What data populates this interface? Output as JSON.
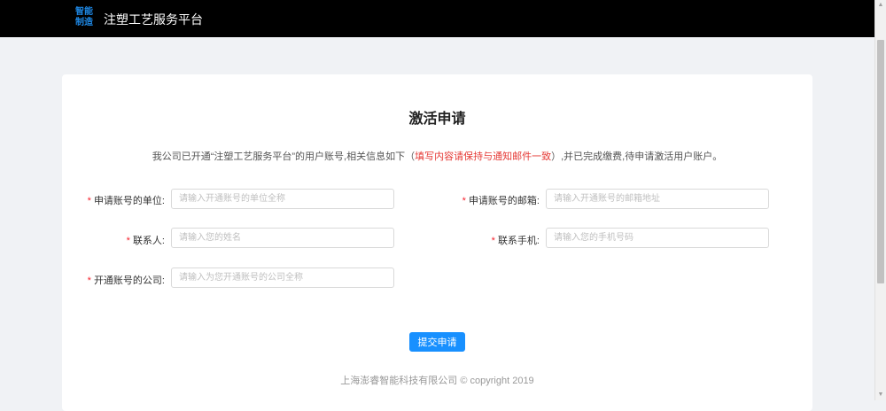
{
  "header": {
    "logo_line1": "智能",
    "logo_line2": "制造",
    "title": "注塑工艺服务平台"
  },
  "form": {
    "title": "激活申请",
    "intro_before": "我公司已开通“注塑工艺服务平台”的用户账号,相关信息如下（",
    "intro_highlight": "填写内容请保持与通知邮件一致",
    "intro_after": "）,并已完成缴费,待申请激活用户账户。",
    "required_mark": "*",
    "fields": [
      {
        "label": "申请账号的单位:",
        "placeholder": "请输入开通账号的单位全称"
      },
      {
        "label": "申请账号的邮箱:",
        "placeholder": "请输入开通账号的邮箱地址"
      },
      {
        "label": "联系人:",
        "placeholder": "请输入您的姓名"
      },
      {
        "label": "联系手机:",
        "placeholder": "请输入您的手机号码"
      },
      {
        "label": "开通账号的公司:",
        "placeholder": "请输入为您开通账号的公司全称"
      }
    ],
    "submit_label": "提交申请"
  },
  "footer": {
    "text": "上海澎睿智能科技有限公司 © copyright 2019"
  },
  "colors": {
    "header_bg": "#000000",
    "logo": "#1e88e5",
    "required": "#f5222d",
    "highlight": "#e53935",
    "primary": "#1890ff"
  }
}
